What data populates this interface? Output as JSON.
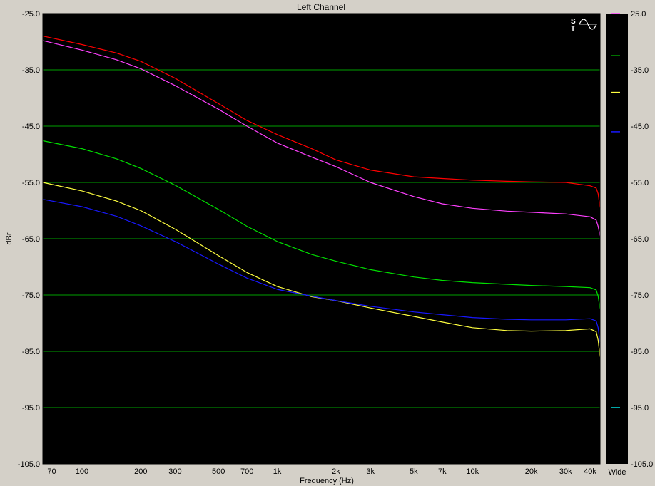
{
  "chart_data": {
    "type": "line",
    "title": "Left Channel",
    "xlabel": "Frequency (Hz)",
    "ylabel": "dBr",
    "x_scale": "log",
    "xlim": [
      63,
      45000
    ],
    "ylim": [
      -105,
      -25
    ],
    "grid": true,
    "background": "#000000",
    "grid_color": "#00a000",
    "x_ticks": [
      70,
      100,
      200,
      300,
      500,
      700,
      1000,
      2000,
      3000,
      5000,
      7000,
      10000,
      20000,
      30000,
      40000
    ],
    "x_tick_labels": [
      "70",
      "100",
      "200",
      "300",
      "500",
      "700",
      "1k",
      "2k",
      "3k",
      "5k",
      "7k",
      "10k",
      "20k",
      "30k",
      "40k"
    ],
    "y_ticks": [
      -25,
      -35,
      -45,
      -55,
      -65,
      -75,
      -85,
      -95,
      -105
    ],
    "y_tick_labels": [
      "-25.0",
      "-35.0",
      "-45.0",
      "-55.0",
      "-65.0",
      "-75.0",
      "-85.0",
      "-95.0",
      "-105.0"
    ],
    "right_tick_labels": [
      "25.0",
      "-35.0",
      "-45.0",
      "-55.0",
      "-65.0",
      "-75.0",
      "-85.0",
      "-95.0",
      "-105.0"
    ],
    "right_axis_label": "Wide",
    "series": [
      {
        "color": "#ff0000",
        "x": [
          63,
          100,
          150,
          200,
          300,
          500,
          700,
          1000,
          1500,
          2000,
          3000,
          5000,
          7000,
          10000,
          15000,
          20000,
          30000,
          40000,
          43000,
          44000,
          45000
        ],
        "y": [
          -29,
          -30.5,
          -32,
          -33.5,
          -36.5,
          -41,
          -44,
          -46.5,
          -49,
          -51,
          -52.8,
          -54,
          -54.3,
          -54.6,
          -54.8,
          -54.9,
          -55,
          -55.6,
          -56,
          -57,
          -59.5
        ]
      },
      {
        "color": "#ff40ff",
        "x": [
          63,
          100,
          150,
          200,
          300,
          500,
          700,
          1000,
          1500,
          2000,
          3000,
          5000,
          7000,
          10000,
          15000,
          20000,
          30000,
          40000,
          43000,
          44000,
          45000
        ],
        "y": [
          -29.8,
          -31.5,
          -33.2,
          -34.8,
          -37.8,
          -42,
          -45,
          -48,
          -50.5,
          -52.2,
          -55,
          -57.5,
          -58.8,
          -59.6,
          -60.1,
          -60.3,
          -60.6,
          -61.1,
          -61.7,
          -62.8,
          -64.5
        ]
      },
      {
        "color": "#00e000",
        "x": [
          63,
          100,
          150,
          200,
          300,
          500,
          700,
          1000,
          1500,
          2000,
          3000,
          5000,
          7000,
          10000,
          15000,
          20000,
          30000,
          40000,
          43000,
          44000,
          45000
        ],
        "y": [
          -47.6,
          -49,
          -50.8,
          -52.5,
          -55.5,
          -59.8,
          -62.8,
          -65.5,
          -67.8,
          -69,
          -70.5,
          -71.8,
          -72.4,
          -72.8,
          -73.1,
          -73.3,
          -73.5,
          -73.7,
          -74.1,
          -75.2,
          -77.5
        ]
      },
      {
        "color": "#ffff40",
        "x": [
          63,
          100,
          150,
          200,
          300,
          500,
          700,
          1000,
          1500,
          2000,
          3000,
          5000,
          7000,
          10000,
          15000,
          20000,
          30000,
          40000,
          43000,
          44000,
          45000
        ],
        "y": [
          -55,
          -56.5,
          -58.3,
          -60,
          -63.3,
          -68,
          -71,
          -73.5,
          -75.3,
          -76,
          -77.3,
          -78.8,
          -79.8,
          -80.8,
          -81.3,
          -81.4,
          -81.3,
          -81,
          -81.5,
          -83,
          -86
        ]
      },
      {
        "color": "#1818ff",
        "x": [
          63,
          100,
          150,
          200,
          300,
          500,
          700,
          1000,
          1500,
          2000,
          3000,
          5000,
          7000,
          10000,
          15000,
          20000,
          30000,
          40000,
          43000,
          44000,
          45000
        ],
        "y": [
          -58,
          -59.3,
          -61,
          -62.7,
          -65.5,
          -69.5,
          -72,
          -74,
          -75.2,
          -76,
          -77,
          -78,
          -78.5,
          -79,
          -79.3,
          -79.4,
          -79.4,
          -79.2,
          -79.6,
          -80.8,
          -83.5
        ]
      }
    ],
    "right_markers": [
      {
        "color": "#ff40ff",
        "y": -25
      },
      {
        "color": "#00e000",
        "y": -32.5
      },
      {
        "color": "#ffff40",
        "y": -39
      },
      {
        "color": "#1818ff",
        "y": -46
      },
      {
        "color": "#00e0e0",
        "y": -95
      }
    ]
  },
  "widgets": {
    "bandwidth_label": "Wide",
    "logo_text": "ST",
    "icons": [
      "ap-logo-icon",
      "sine-wave-icon"
    ]
  }
}
